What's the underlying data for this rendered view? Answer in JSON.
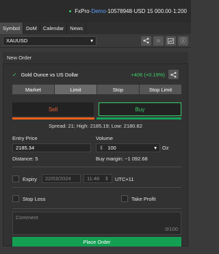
{
  "topbar": {
    "app": "FxPro",
    "sep1": " · ",
    "mode": "Demo",
    "sep2": " · ",
    "account": "10578948",
    "sep3": " · ",
    "balance": "USD 15 000.00",
    "sep4": " · ",
    "leverage": "1:200"
  },
  "tabs": [
    {
      "label": "Symbol"
    },
    {
      "label": "DoM"
    },
    {
      "label": "Calendar"
    },
    {
      "label": "News"
    }
  ],
  "symbol": {
    "value": "XAUUSD"
  },
  "panel": {
    "title": "New Order"
  },
  "instrument": {
    "name": "Gold Ounce vs US Dollar",
    "change": "+406 (+0.19%)"
  },
  "order_types": [
    {
      "label": "Market"
    },
    {
      "label": "Limit"
    },
    {
      "label": "Stop"
    },
    {
      "label": "Stop Limit"
    }
  ],
  "trade": {
    "sell": "Sell",
    "buy": "Buy"
  },
  "spread": "Spread: 21; High: 2185.19; Low: 2180.82",
  "entry": {
    "label": "Entry Price",
    "value": "2185.34",
    "distance": "Distance: 5"
  },
  "volume": {
    "label": "Volume",
    "value": "100",
    "unit": "Oz",
    "margin": "Buy margin: ~1 092.68"
  },
  "expiry": {
    "label": "Expiry",
    "date": "22/03/2024",
    "time": "11:48",
    "tz": "UTC+11"
  },
  "stop_loss": "Stop Loss",
  "take_profit": "Take Profit",
  "comment": {
    "placeholder": "Comment",
    "count": "0/100"
  },
  "place_order": "Place Order"
}
